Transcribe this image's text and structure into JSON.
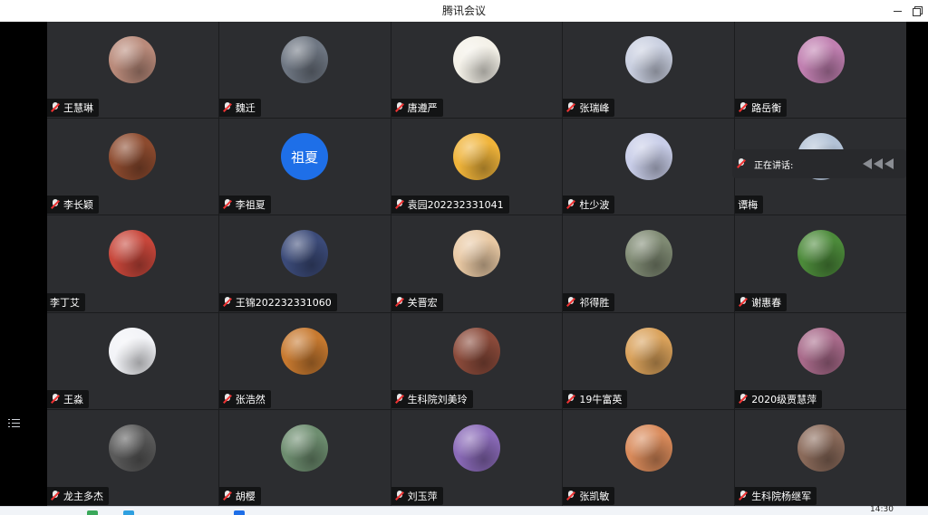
{
  "window": {
    "title": "腾讯会议"
  },
  "speaking": {
    "label": "正在讲话:"
  },
  "taskbar": {
    "time": "14:30"
  },
  "participants": [
    {
      "name": "王慧琳",
      "muted": true,
      "avatar": {
        "type": "photo",
        "color": "#b98a7a"
      }
    },
    {
      "name": "魏迁",
      "muted": true,
      "avatar": {
        "type": "photo",
        "color": "#6e7682"
      }
    },
    {
      "name": "唐遵严",
      "muted": true,
      "avatar": {
        "type": "photo",
        "color": "#f4f1e8"
      }
    },
    {
      "name": "张瑞峰",
      "muted": true,
      "avatar": {
        "type": "photo",
        "color": "#c9cfe0"
      }
    },
    {
      "name": "路岳衡",
      "muted": true,
      "avatar": {
        "type": "photo",
        "color": "#c07fb0"
      }
    },
    {
      "name": "李长颖",
      "muted": true,
      "avatar": {
        "type": "photo",
        "color": "#8c4a2e"
      }
    },
    {
      "name": "李祖夏",
      "muted": true,
      "avatar": {
        "type": "text",
        "text": "祖夏",
        "color": "#1e6fe8"
      }
    },
    {
      "name": "袁园202232331041",
      "muted": true,
      "avatar": {
        "type": "photo",
        "color": "#f0b43a"
      }
    },
    {
      "name": "杜少波",
      "muted": true,
      "avatar": {
        "type": "photo",
        "color": "#c8cde8"
      }
    },
    {
      "name": "谭梅",
      "muted": false,
      "avatar": {
        "type": "photo",
        "color": "#b2c2d6"
      }
    },
    {
      "name": "李丁艾",
      "muted": false,
      "avatar": {
        "type": "photo",
        "color": "#c7463a"
      }
    },
    {
      "name": "王锦202232331060",
      "muted": true,
      "avatar": {
        "type": "photo",
        "color": "#3b4a78"
      }
    },
    {
      "name": "关晋宏",
      "muted": true,
      "avatar": {
        "type": "photo",
        "color": "#e9c9a4"
      }
    },
    {
      "name": "祁得胜",
      "muted": true,
      "avatar": {
        "type": "photo",
        "color": "#7f8a73"
      }
    },
    {
      "name": "谢惠春",
      "muted": true,
      "avatar": {
        "type": "photo",
        "color": "#4c8a3a"
      }
    },
    {
      "name": "王淼",
      "muted": true,
      "avatar": {
        "type": "photo",
        "color": "#f2f3f7"
      }
    },
    {
      "name": "张浩然",
      "muted": true,
      "avatar": {
        "type": "photo",
        "color": "#c7792f"
      }
    },
    {
      "name": "生科院刘美玲",
      "muted": true,
      "avatar": {
        "type": "photo",
        "color": "#8a4a3a"
      }
    },
    {
      "name": "19牛富英",
      "muted": true,
      "avatar": {
        "type": "photo",
        "color": "#d9a15a"
      }
    },
    {
      "name": "2020级贾慧萍",
      "muted": true,
      "avatar": {
        "type": "photo",
        "color": "#a86a8a"
      }
    },
    {
      "name": "龙主多杰",
      "muted": true,
      "avatar": {
        "type": "photo",
        "color": "#5a5a5a"
      }
    },
    {
      "name": "胡樱",
      "muted": true,
      "avatar": {
        "type": "photo",
        "color": "#6d8d6f"
      }
    },
    {
      "name": "刘玉萍",
      "muted": true,
      "avatar": {
        "type": "photo",
        "color": "#8a6ab8"
      }
    },
    {
      "name": "张凯敏",
      "muted": true,
      "avatar": {
        "type": "photo",
        "color": "#d98a5a"
      }
    },
    {
      "name": "生科院杨继军",
      "muted": true,
      "avatar": {
        "type": "photo",
        "color": "#8a6a5a"
      }
    }
  ]
}
